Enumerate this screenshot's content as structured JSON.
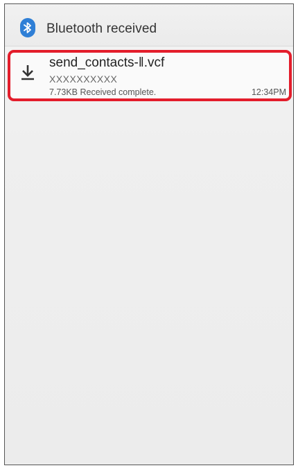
{
  "header": {
    "icon": "bluetooth-icon",
    "title": "Bluetooth received"
  },
  "notification": {
    "icon": "download-icon",
    "file_name": "send_contacts-‖.vcf",
    "sender": "XXXXXXXXXX",
    "status": "7.73KB Received complete.",
    "time": "12:34PM"
  },
  "colors": {
    "bluetooth": "#2f7fd6",
    "highlight": "#e31d2b"
  }
}
